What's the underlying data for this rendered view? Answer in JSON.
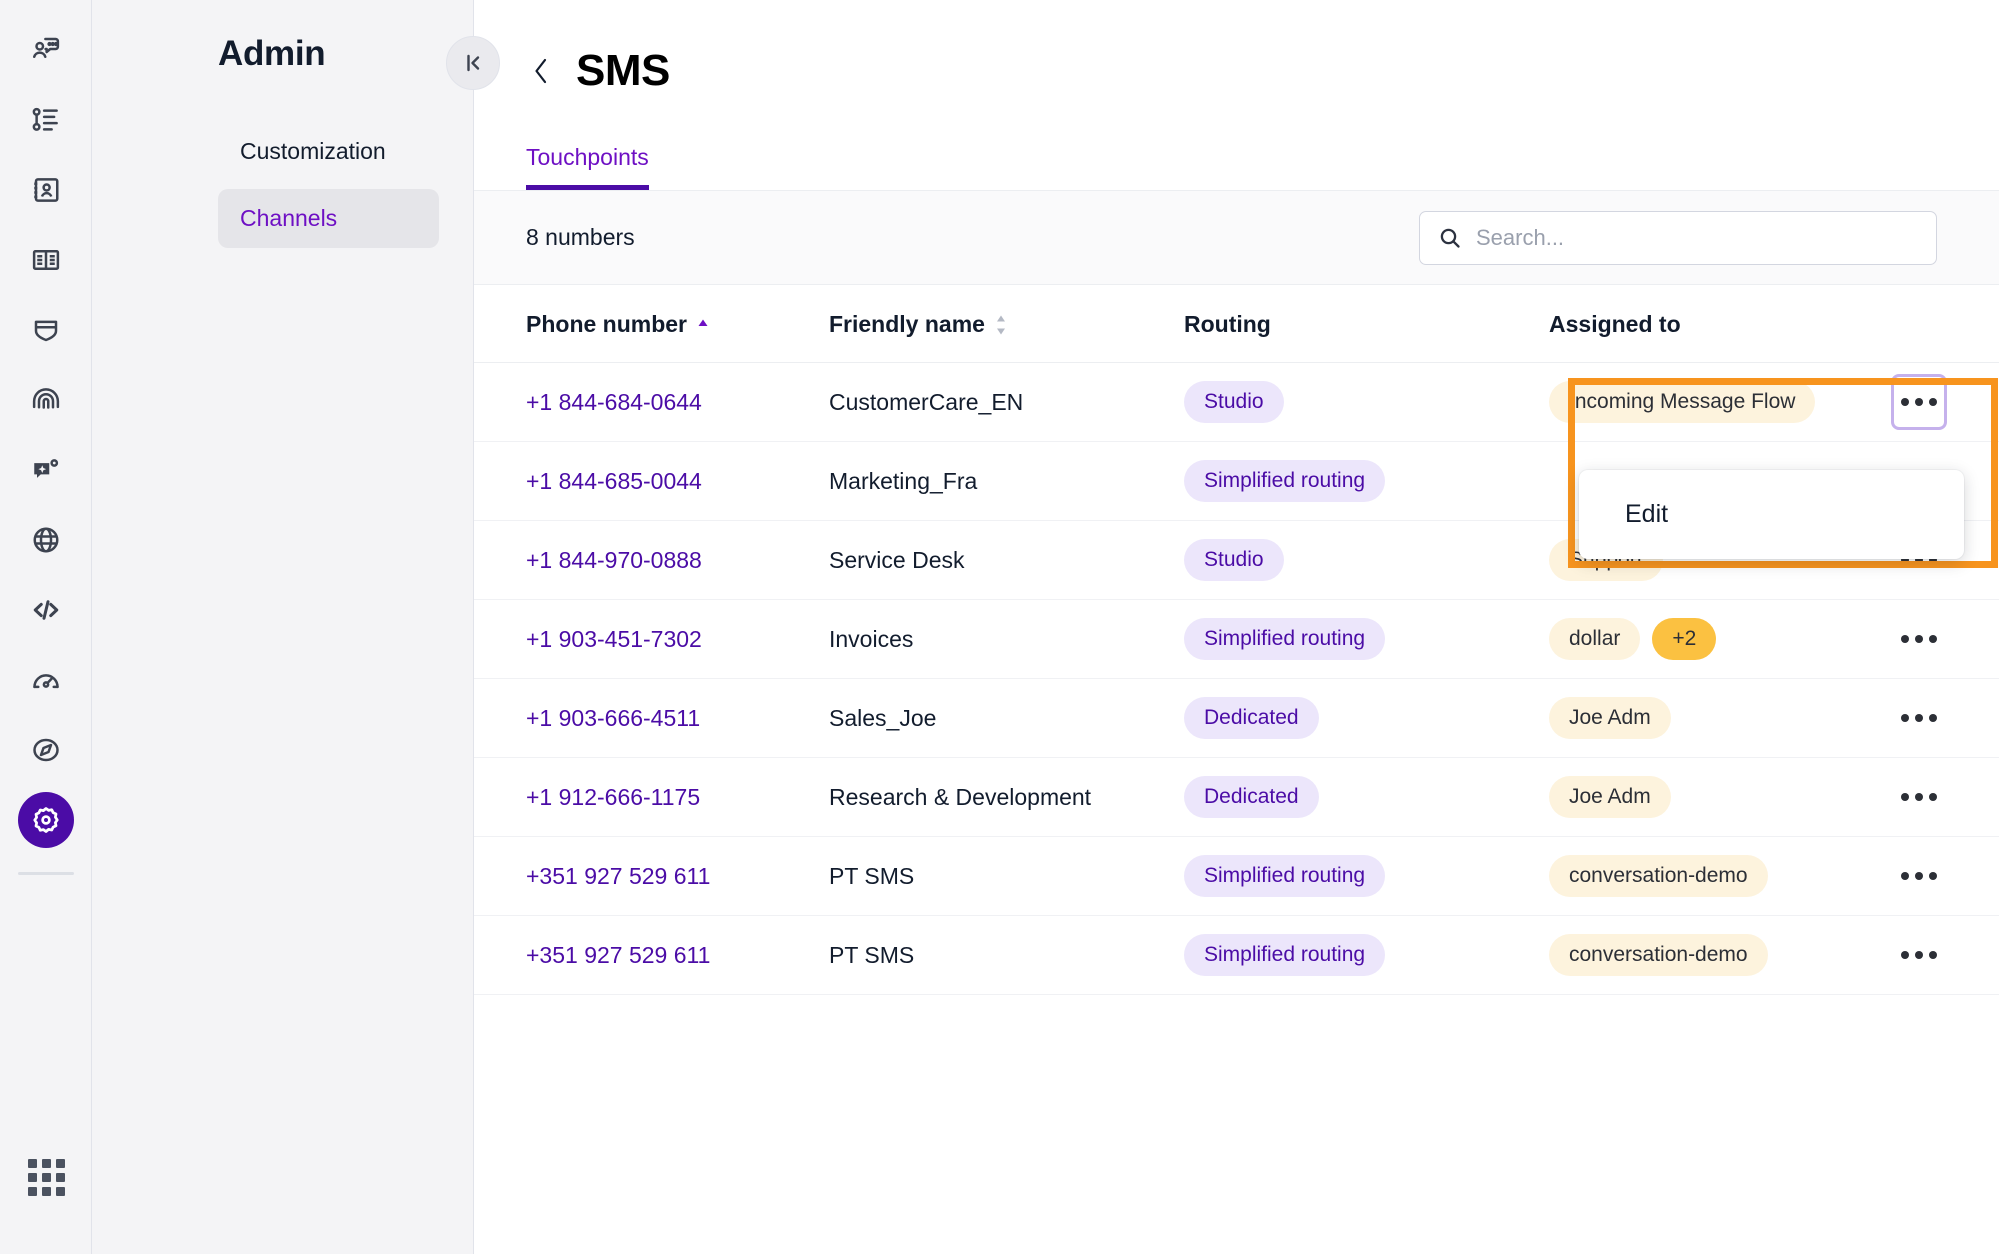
{
  "rail": {
    "items": [
      {
        "name": "conversations-icon",
        "label": "Conversations"
      },
      {
        "name": "flows-list-icon",
        "label": "Flows"
      },
      {
        "name": "contacts-book-icon",
        "label": "Contacts"
      },
      {
        "name": "knowledge-book-icon",
        "label": "Knowledge"
      },
      {
        "name": "shield-icon",
        "label": "Trust"
      },
      {
        "name": "fingerprint-icon",
        "label": "Identity"
      },
      {
        "name": "ai-assistant-icon",
        "label": "AI Assistants"
      },
      {
        "name": "globe-icon",
        "label": "Global"
      },
      {
        "name": "code-icon",
        "label": "Developer"
      },
      {
        "name": "gauge-icon",
        "label": "Monitor"
      },
      {
        "name": "compass-icon",
        "label": "Explore"
      },
      {
        "name": "gear-icon",
        "label": "Admin"
      }
    ],
    "bottom_icon": "apps-grid-icon"
  },
  "sidebar": {
    "title": "Admin",
    "collapse_icon": "collapse-panel-icon",
    "items": [
      {
        "label": "Customization",
        "selected": false
      },
      {
        "label": "Channels",
        "selected": true
      }
    ]
  },
  "header": {
    "back_icon": "chevron-left-icon",
    "title": "SMS"
  },
  "tabs": [
    {
      "label": "Touchpoints",
      "active": true
    }
  ],
  "toolbar": {
    "count_text": "8 numbers",
    "search": {
      "icon": "search-icon",
      "placeholder": "Search...",
      "value": ""
    }
  },
  "table": {
    "columns": [
      {
        "label": "Phone number",
        "sort": "asc"
      },
      {
        "label": "Friendly name",
        "sort": "none"
      },
      {
        "label": "Routing",
        "sort": null
      },
      {
        "label": "Assigned to",
        "sort": null
      }
    ],
    "rows": [
      {
        "phone": "+1 844-684-0644",
        "friendly_name": "CustomerCare_EN",
        "routing": "Studio",
        "assigned": [
          "Incoming Message Flow"
        ],
        "extra_count": null,
        "actions_icon": "ellipsis-icon",
        "actions_focused": true
      },
      {
        "phone": "+1 844-685-0044",
        "friendly_name": "Marketing_Fra",
        "routing": "Simplified routing",
        "assigned": [
          ""
        ],
        "extra_count": null,
        "actions_icon": "ellipsis-icon",
        "actions_focused": false
      },
      {
        "phone": "+1 844-970-0888",
        "friendly_name": "Service Desk",
        "routing": "Studio",
        "assigned": [
          "Support"
        ],
        "extra_count": null,
        "actions_icon": "ellipsis-icon",
        "actions_focused": false
      },
      {
        "phone": "+1 903-451-7302",
        "friendly_name": "Invoices",
        "routing": "Simplified routing",
        "assigned": [
          "dollar"
        ],
        "extra_count": "+2",
        "actions_icon": "ellipsis-icon",
        "actions_focused": false
      },
      {
        "phone": "+1 903-666-4511",
        "friendly_name": "Sales_Joe",
        "routing": "Dedicated",
        "assigned": [
          "Joe Adm"
        ],
        "extra_count": null,
        "actions_icon": "ellipsis-icon",
        "actions_focused": false
      },
      {
        "phone": "+1 912-666-1175",
        "friendly_name": "Research & Development",
        "routing": "Dedicated",
        "assigned": [
          "Joe Adm"
        ],
        "extra_count": null,
        "actions_icon": "ellipsis-icon",
        "actions_focused": false
      },
      {
        "phone": "+351 927 529 611",
        "friendly_name": "PT SMS",
        "routing": "Simplified routing",
        "assigned": [
          "conversation-demo"
        ],
        "extra_count": null,
        "actions_icon": "ellipsis-icon",
        "actions_focused": false
      },
      {
        "phone": "+351 927 529 611",
        "friendly_name": "PT SMS",
        "routing": "Simplified routing",
        "assigned": [
          "conversation-demo"
        ],
        "extra_count": null,
        "actions_icon": "ellipsis-icon",
        "actions_focused": false
      }
    ]
  },
  "dropdown": {
    "items": [
      {
        "label": "Edit"
      }
    ]
  },
  "annotation": {
    "highlight_color": "#f7941e"
  },
  "colors": {
    "brand_purple": "#4b0ca6",
    "link_purple": "#6e10c4",
    "routing_pill_bg": "#ece6fb",
    "assign_pill_bg": "#fdf3dd",
    "count_pill_bg": "#fbc141",
    "highlight_orange": "#f7941e",
    "focus_outline": "#c5b1ec"
  }
}
